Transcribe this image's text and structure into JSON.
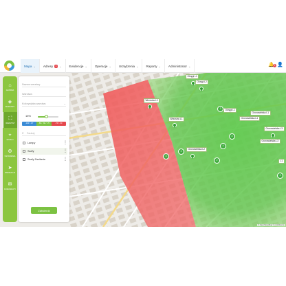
{
  "nav": {
    "items": [
      {
        "label": "Mapa",
        "active": true
      },
      {
        "label": "Adresy",
        "badge": "1"
      },
      {
        "label": "Ewidencje"
      },
      {
        "label": "Operacje"
      },
      {
        "label": "Urządzenia"
      },
      {
        "label": "Raporty"
      },
      {
        "label": "Administrator"
      }
    ],
    "notifications": "1"
  },
  "sidebar": {
    "items": [
      {
        "label": "GŁÓWNA",
        "icon": "home-icon"
      },
      {
        "label": "WARSTWY",
        "icon": "layers-icon"
      },
      {
        "label": "WARSTWY",
        "icon": "frame-icon",
        "active": true
      },
      {
        "label": "SZUKAJ",
        "icon": "search-pin-icon"
      },
      {
        "label": "USTAWIENIA",
        "icon": "gear-icon"
      },
      {
        "label": "NAWIGACJA",
        "icon": "navigation-icon"
      },
      {
        "label": "KOMUNIKATY",
        "icon": "message-icon"
      }
    ]
  },
  "panel": {
    "field1": "Nazwa warstwy",
    "field2": "Warstwa",
    "field3": "Kolorystyka warstwy",
    "opacity": "15%",
    "opacity_fraction": 0.4,
    "legend": [
      {
        "label": "-100 / -87",
        "color": "#3a8bd6"
      },
      {
        "label": "-86 / -80 / -70",
        "color": "#7cc242"
      },
      {
        "label": "-70 / -60",
        "color": "#e5484d"
      }
    ],
    "search_placeholder": "Szukaj",
    "layers": [
      {
        "name": "Lampy"
      },
      {
        "name": "Szafy",
        "selected": true
      },
      {
        "name": "Szafy Zasilania"
      }
    ],
    "save_label": "Zatwierdź"
  },
  "map": {
    "labels": [
      {
        "text": "Okręgi L1"
      },
      {
        "text": "Okręgi L2"
      },
      {
        "text": "Wrzosów L2"
      },
      {
        "text": "Okręgi L1"
      },
      {
        "text": "Gronowielska L1"
      },
      {
        "text": "Wrzosów L1"
      },
      {
        "text": "Gronowielska L4"
      },
      {
        "text": "Gronowielska L3"
      },
      {
        "text": "Gronowielska L2"
      },
      {
        "text": "Gronowielska L3"
      },
      {
        "text": "L1"
      }
    ],
    "clusters": [
      "2",
      "2",
      "4",
      "2",
      "3",
      "2",
      "2"
    ],
    "attribution": "© OpenStreetMap © contributors"
  }
}
